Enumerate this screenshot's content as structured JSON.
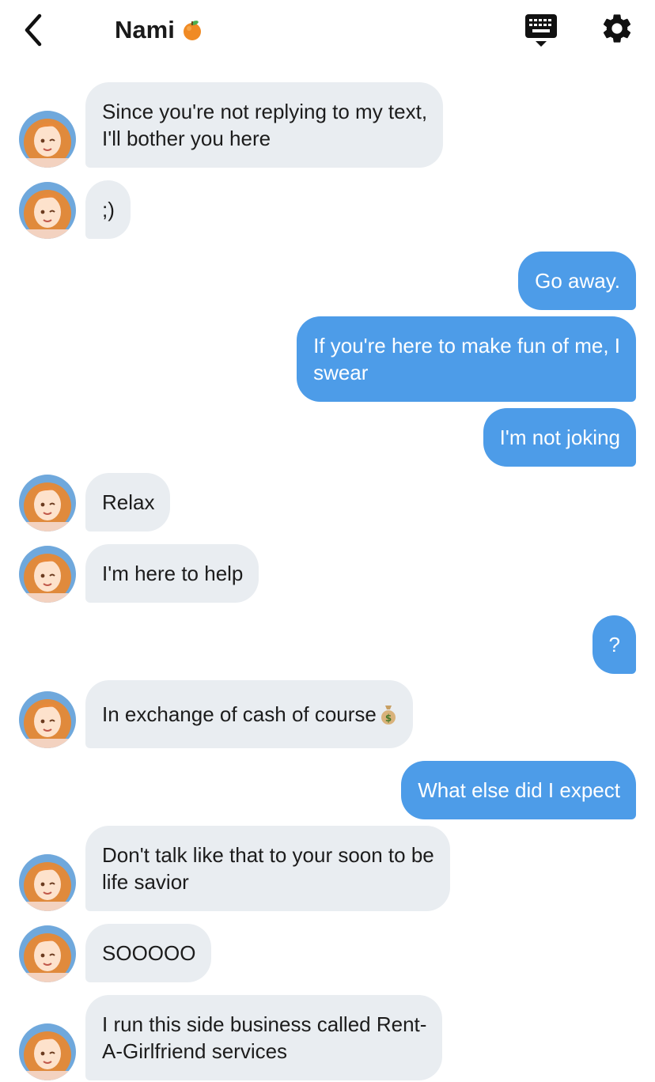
{
  "header": {
    "back_icon": "chevron-left-icon",
    "title": "Nami",
    "title_emoji": "tangerine-emoji",
    "keyboard_icon": "keyboard-icon",
    "settings_icon": "gear-icon"
  },
  "colors": {
    "incoming_bubble": "#e9edf1",
    "outgoing_bubble": "#4d9ce8",
    "incoming_text": "#1c1c1c",
    "outgoing_text": "#ffffff"
  },
  "messages": [
    {
      "from": "them",
      "text": "Since you're not replying to my text,\nI'll bother you here"
    },
    {
      "from": "them",
      "text": ";)"
    },
    {
      "from": "me",
      "text": "Go away."
    },
    {
      "from": "me",
      "text": "If you're here to make fun of me, I\nswear"
    },
    {
      "from": "me",
      "text": "I'm not joking"
    },
    {
      "from": "them",
      "text": "Relax"
    },
    {
      "from": "them",
      "text": "I'm here to help"
    },
    {
      "from": "me",
      "text": "?"
    },
    {
      "from": "them",
      "text": "In exchange of cash of course",
      "emoji": "money-bag-emoji"
    },
    {
      "from": "me",
      "text": "What else did I expect"
    },
    {
      "from": "them",
      "text": "Don't talk like that to your soon to be\nlife savior"
    },
    {
      "from": "them",
      "text": "SOOOOO"
    },
    {
      "from": "them",
      "text": "I run this side business called Rent-\nA-Girlfriend services"
    }
  ]
}
